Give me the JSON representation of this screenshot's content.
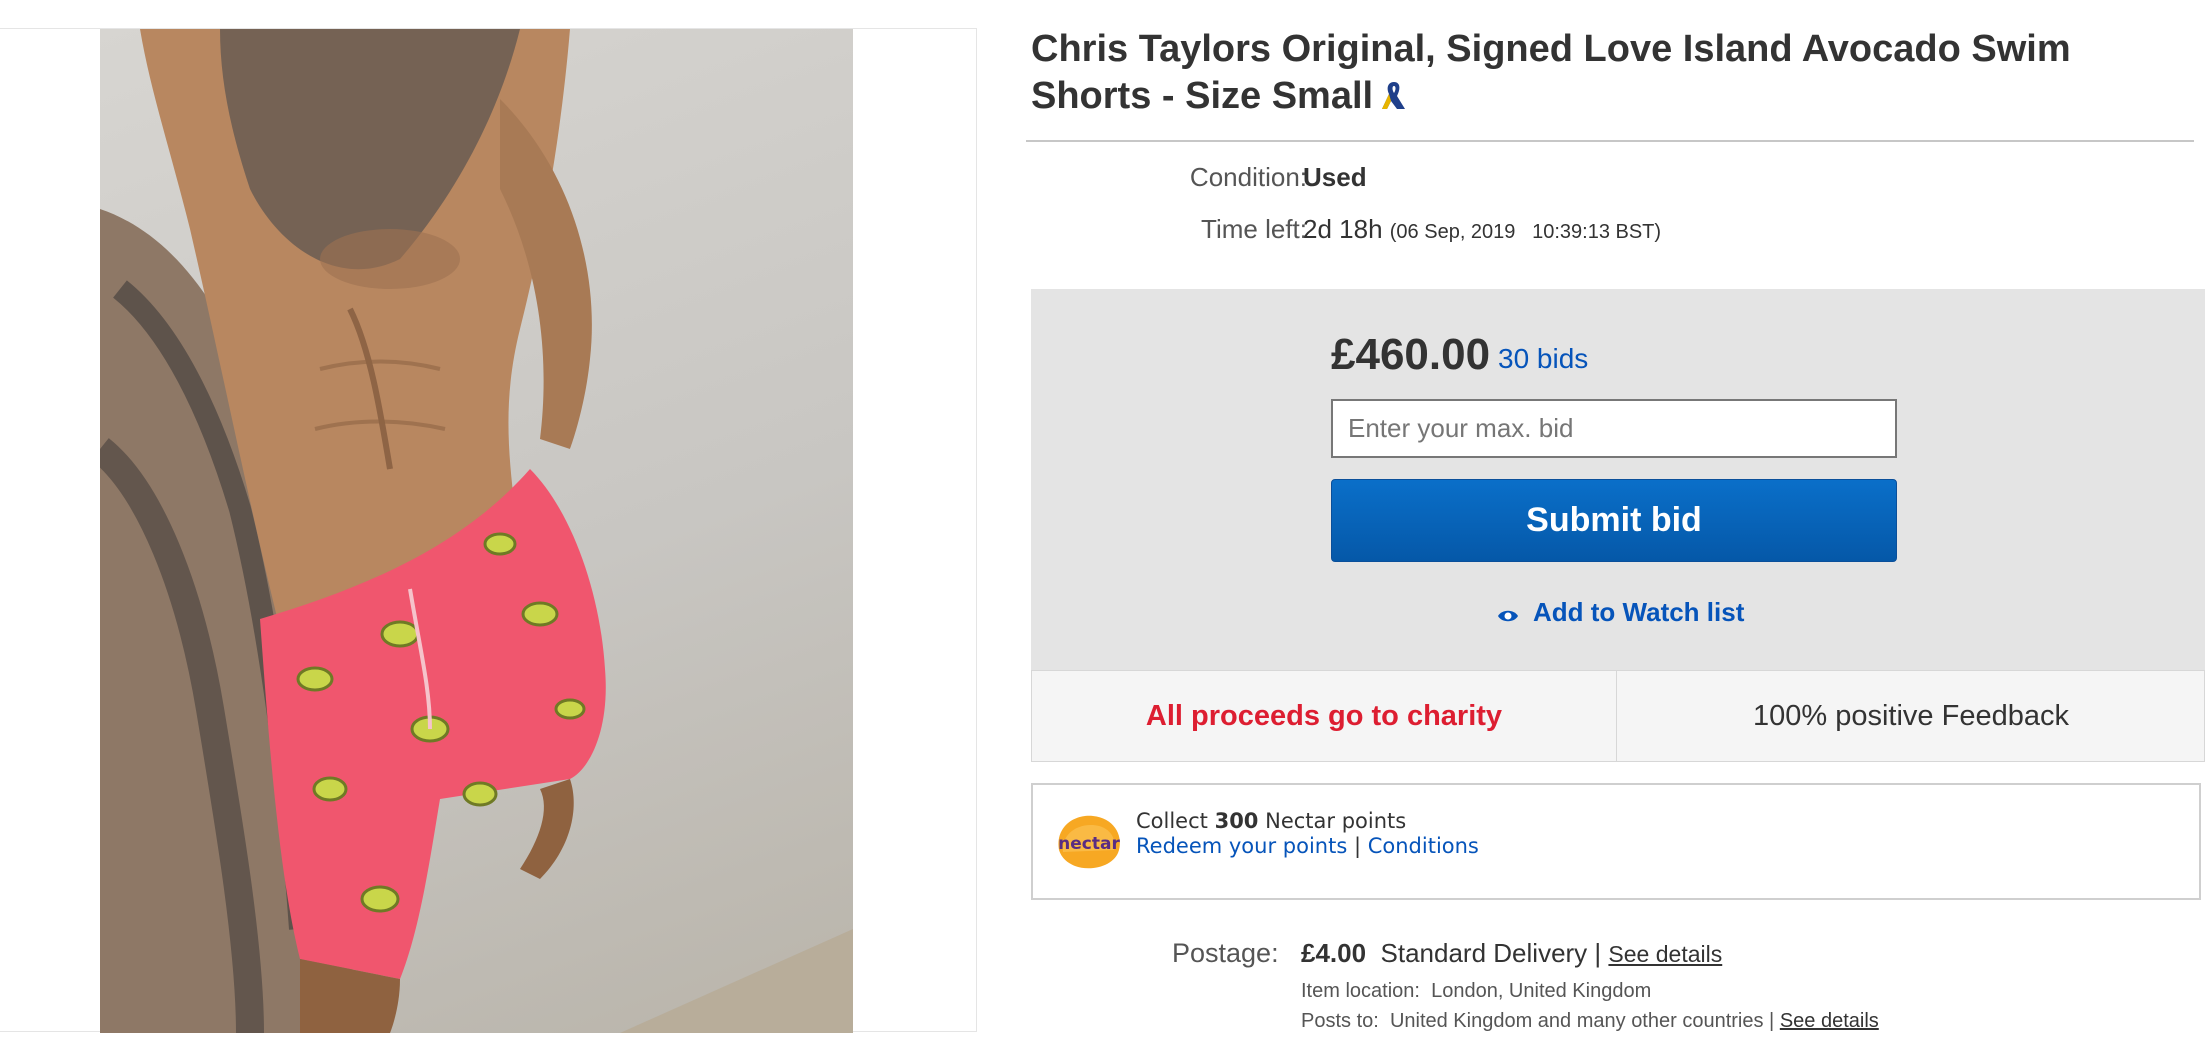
{
  "listing": {
    "title": "Chris Taylors Original, Signed Love Island Avocado Swim Shorts - Size Small",
    "ribbon_icon": "awareness-ribbon-icon"
  },
  "details": {
    "condition_label": "Condition:",
    "condition_value": "Used",
    "time_left_label": "Time left:",
    "time_left_value": "2d 18h",
    "time_left_end": "(06 Sep, 2019   10:39:13 BST)"
  },
  "bidding": {
    "price": "£460.00",
    "bids_link": "30 bids",
    "input_placeholder": "Enter your max. bid",
    "submit_label": "Submit bid",
    "watch_label": "Add to Watch list",
    "accent_color": "#0654ba"
  },
  "banner": {
    "charity_text": "All proceeds go to charity",
    "charity_color": "#dd1e31",
    "feedback_text": "100% positive Feedback"
  },
  "nectar": {
    "logo_text": "nectar",
    "collect_prefix": "Collect",
    "points": "300",
    "collect_suffix": "Nectar points",
    "redeem_link": "Redeem your points",
    "separator": "|",
    "conditions_link": "Conditions"
  },
  "postage": {
    "label": "Postage:",
    "price": "£4.00",
    "service": "Standard Delivery",
    "separator": "|",
    "details_link": "See details",
    "location_label": "Item location:",
    "location_value": "London, United Kingdom",
    "posts_label": "Posts to:",
    "posts_value": "United Kingdom and many other countries",
    "posts_separator": "|",
    "posts_details_link": "See details"
  }
}
